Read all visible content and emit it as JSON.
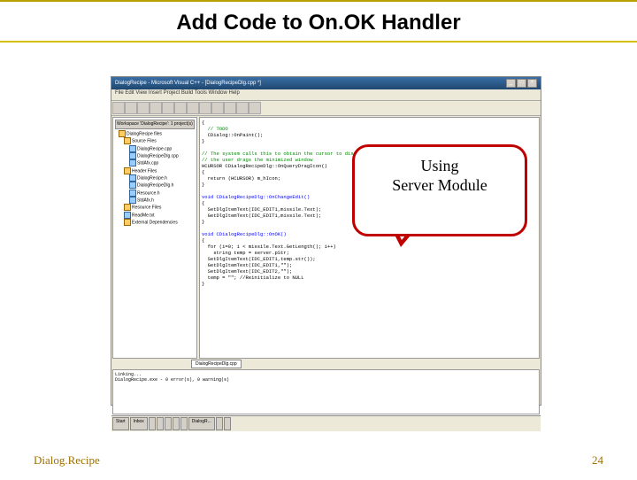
{
  "slide": {
    "title": "Add Code to On.OK Handler",
    "footer_left": "Dialog.Recipe",
    "footer_right": "24"
  },
  "callout": {
    "line1": "Using",
    "line2": "Server Module"
  },
  "ide": {
    "window_title": "DialogRecipe - Microsoft Visual C++ - [DialogRecipeDlg.cpp *]",
    "menu": "File  Edit  View  Insert  Project  Build  Tools  Window  Help",
    "tree": {
      "header": "Workspace 'DialogRecipe': 1 project(s)",
      "project": "DialogRecipe files",
      "source_folder": "Source Files",
      "sources": [
        "DialogRecipe.cpp",
        "DialogRecipeDlg.cpp",
        "StdAfx.cpp"
      ],
      "header_folder": "Header Files",
      "headers": [
        "DialogRecipe.h",
        "DialogRecipeDlg.h",
        "Resource.h",
        "StdAfx.h"
      ],
      "resource_folder": "Resource Files",
      "readme": "ReadMe.txt",
      "external": "External Dependencies"
    },
    "tab_label": "DialogRecipeDlg.cpp",
    "code_lines": [
      "{",
      "  // TODO",
      "  CDialog::OnPaint();",
      "}",
      "",
      "// The system calls this to obtain the cursor to display while",
      "// the user drags the minimized window",
      "HCURSOR CDialogRecipeDlg::OnQueryDragIcon()",
      "{",
      "  return (HCURSOR) m_hIcon;",
      "}",
      "",
      "void CDialogRecipeDlg::OnChangeEdit()",
      "{",
      "  SetDlgItemText(IDC_EDIT1,missile.Text);",
      "  GetDlgItemText(IDC_EDIT1,missile.Text);",
      "}",
      "",
      "void CDialogRecipeDlg::OnOK()",
      "{",
      "  for (i=0; i < missile.Text.GetLength(); i++)",
      "    string temp = server.pStr;",
      "  SetDlgItemText(IDC_EDIT1,temp.str());",
      "  GetDlgItemText(IDC_EDIT1,\"\");",
      "  SetDlgItemText(IDC_EDIT2,\"\");",
      "  temp = \"\"; //Reinitialize to NULL",
      "}"
    ],
    "output": {
      "l1": "Linking...",
      "l2": "DialogRecipe.exe - 0 error(s), 0 warning(s)"
    },
    "taskbar": [
      "Start",
      "Inbox",
      "",
      "",
      "",
      "",
      "",
      "DialogR...",
      "",
      "",
      "",
      ""
    ]
  }
}
